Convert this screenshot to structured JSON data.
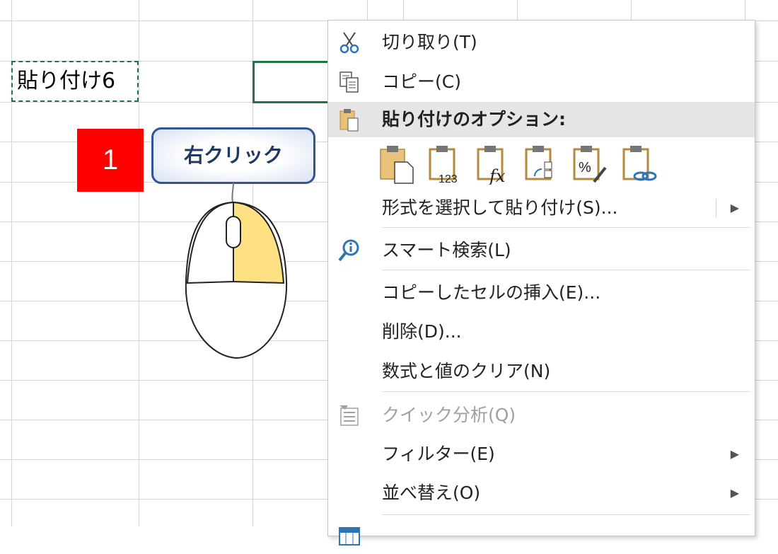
{
  "sheet": {
    "copied_cell_text": "貼り付け6"
  },
  "annotation": {
    "step_number": "1",
    "callout_text": "右クリック"
  },
  "context_menu": {
    "cut": "切り取り(T)",
    "copy": "コピー(C)",
    "paste_options_header": "貼り付けのオプション:",
    "paste_special": "形式を選択して貼り付け(S)...",
    "smart_lookup": "スマート検索(L)",
    "insert_copied_cells": "コピーしたセルの挿入(E)...",
    "delete": "削除(D)...",
    "clear_contents": "数式と値のクリア(N)",
    "quick_analysis": "クイック分析(Q)",
    "filter": "フィルター(E)",
    "sort": "並べ替え(O)",
    "paste_123_label": "123"
  },
  "colors": {
    "selection_green": "#217346",
    "badge_red": "#ff0000",
    "callout_border": "#2f5597",
    "mouse_highlight": "#ffe083",
    "clipboard_tan": "#e8c17a"
  }
}
